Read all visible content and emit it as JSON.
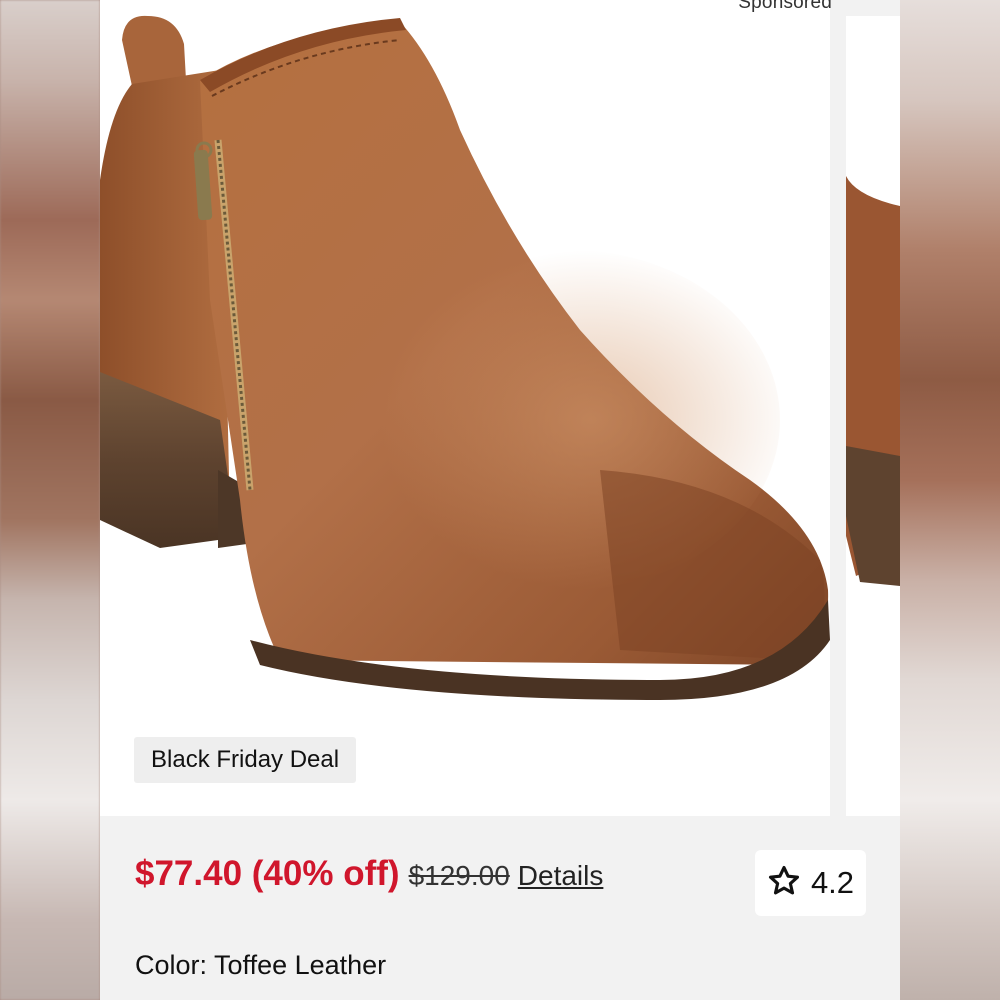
{
  "header": {
    "sponsored_label": "Sponsored"
  },
  "product": {
    "image_icon": "ankle-boot-image",
    "deal_badge": "Black Friday Deal",
    "sale_price": "$77.40 (40% off)",
    "original_price": "$129.00",
    "details_link": "Details",
    "rating": "4.2",
    "rating_icon": "star-outline-icon",
    "color_label": "Color: Toffee Leather"
  },
  "colors": {
    "sale_price": "#d0162c",
    "boot_leather": "#a8653b",
    "heel_wood": "#6a4a33"
  }
}
